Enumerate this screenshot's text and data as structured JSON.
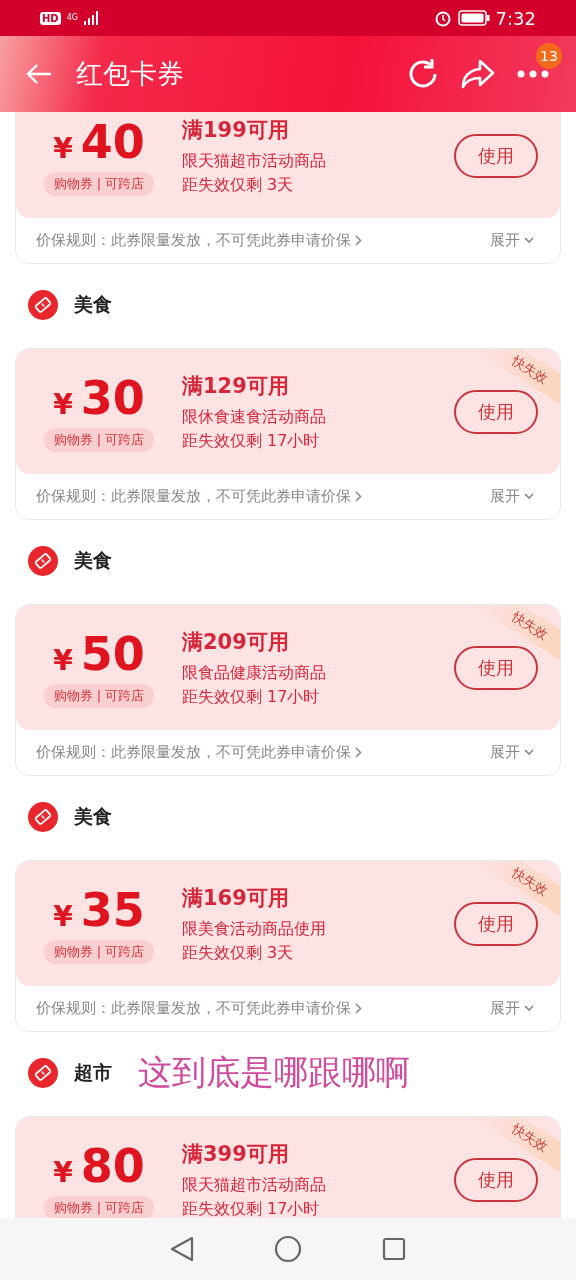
{
  "status_bar": {
    "hd": "HD",
    "network": "4G",
    "time": "7:32"
  },
  "header": {
    "title": "红包卡券",
    "badge": "13"
  },
  "sections": [
    {
      "coupon": {
        "currency": "¥",
        "amount": "40",
        "tag": "购物券 | 可跨店",
        "threshold": "满199可用",
        "scope": "限天猫超市活动商品",
        "expiry": "距失效仅剩 3天",
        "button": "使用",
        "rule": "价保规则：此券限量发放，不可凭此券申请价保",
        "expand": "展开"
      }
    },
    {
      "category": "美食",
      "coupon": {
        "currency": "¥",
        "amount": "30",
        "tag": "购物券 | 可跨店",
        "threshold": "满129可用",
        "scope": "限休食速食活动商品",
        "expiry": "距失效仅剩 17小时",
        "button": "使用",
        "badge": "快失效",
        "rule": "价保规则：此券限量发放，不可凭此券申请价保",
        "expand": "展开"
      }
    },
    {
      "category": "美食",
      "coupon": {
        "currency": "¥",
        "amount": "50",
        "tag": "购物券 | 可跨店",
        "threshold": "满209可用",
        "scope": "限食品健康活动商品",
        "expiry": "距失效仅剩 17小时",
        "button": "使用",
        "badge": "快失效",
        "rule": "价保规则：此券限量发放，不可凭此券申请价保",
        "expand": "展开"
      }
    },
    {
      "category": "美食",
      "coupon": {
        "currency": "¥",
        "amount": "35",
        "tag": "购物券 | 可跨店",
        "threshold": "满169可用",
        "scope": "限美食活动商品使用",
        "expiry": "距失效仅剩 3天",
        "button": "使用",
        "badge": "快失效",
        "rule": "价保规则：此券限量发放，不可凭此券申请价保",
        "expand": "展开"
      }
    },
    {
      "category": "超市",
      "note": "这到底是哪跟哪啊",
      "coupon": {
        "currency": "¥",
        "amount": "80",
        "tag": "购物券 | 可跨店",
        "threshold": "满399可用",
        "scope": "限天猫超市活动商品",
        "expiry": "距失效仅剩 17小时",
        "button": "使用",
        "badge": "快失效"
      }
    }
  ]
}
